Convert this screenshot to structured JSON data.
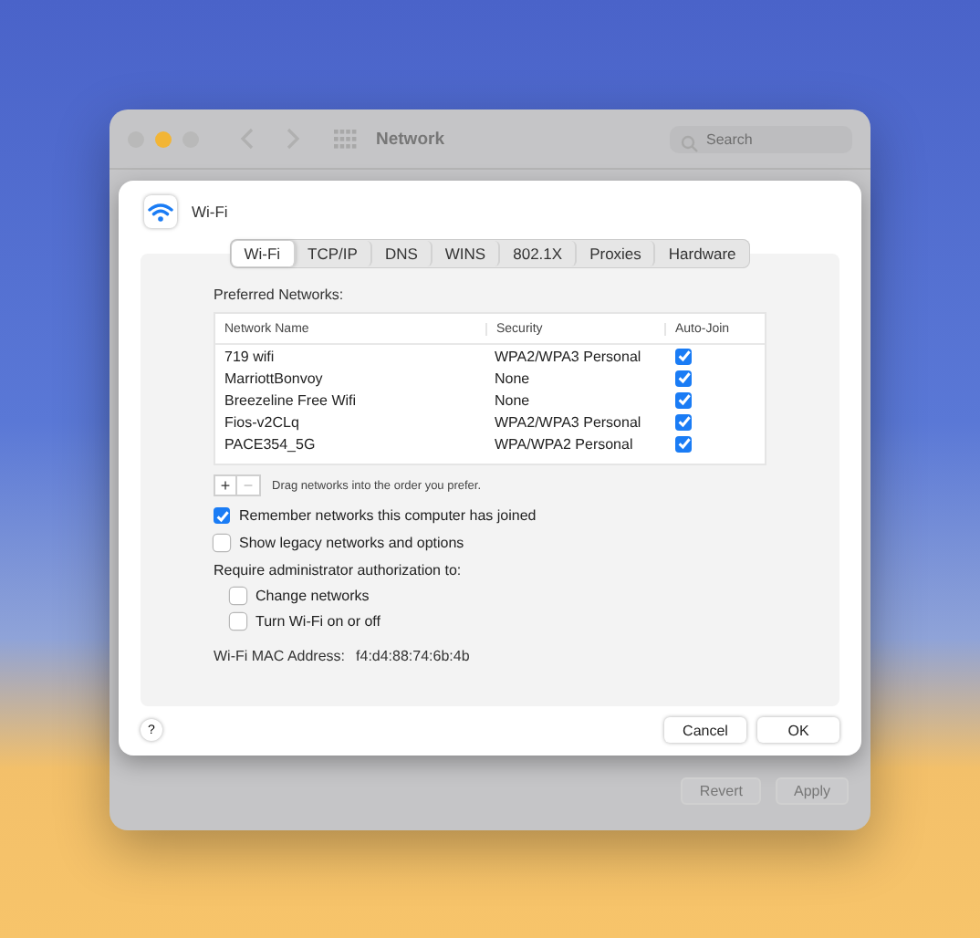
{
  "window": {
    "title": "Network",
    "search": {
      "placeholder": "Search"
    },
    "buttons": [
      {
        "label": "Revert",
        "disabled": true
      },
      {
        "label": "Apply",
        "disabled": true
      }
    ]
  },
  "sheet": {
    "title": "Wi-Fi",
    "tabs": [
      {
        "label": "Wi-Fi",
        "selected": true
      },
      {
        "label": "TCP/IP",
        "selected": false
      },
      {
        "label": "DNS",
        "selected": false
      },
      {
        "label": "WINS",
        "selected": false
      },
      {
        "label": "802.1X",
        "selected": false
      },
      {
        "label": "Proxies",
        "selected": false
      },
      {
        "label": "Hardware",
        "selected": false
      }
    ],
    "preferred_label": "Preferred Networks:",
    "table": {
      "columns": [
        "Network Name",
        "Security",
        "Auto-Join"
      ],
      "rows": [
        {
          "name": "719 wifi",
          "security": "WPA2/WPA3 Personal",
          "auto_join": true
        },
        {
          "name": "MarriottBonvoy",
          "security": "None",
          "auto_join": true
        },
        {
          "name": "Breezeline Free Wifi",
          "security": "None",
          "auto_join": true
        },
        {
          "name": "Fios-v2CLq",
          "security": "WPA2/WPA3 Personal",
          "auto_join": true
        },
        {
          "name": "PACE354_5G",
          "security": "WPA/WPA2 Personal",
          "auto_join": true
        }
      ]
    },
    "add_button": "+",
    "remove_button": "−",
    "hint": "Drag networks into the order you prefer.",
    "options": [
      {
        "label": "Remember networks this computer has joined",
        "checked": true
      },
      {
        "label": "Show legacy networks and options",
        "checked": false
      }
    ],
    "admin_label": "Require administrator authorization to:",
    "admin_options": [
      {
        "label": "Change networks",
        "checked": false
      },
      {
        "label": "Turn Wi-Fi on or off",
        "checked": false
      }
    ],
    "mac_label": "Wi-Fi MAC Address:",
    "mac_value": "f4:d4:88:74:6b:4b",
    "help": "?",
    "buttons": [
      "Cancel",
      "OK"
    ]
  }
}
